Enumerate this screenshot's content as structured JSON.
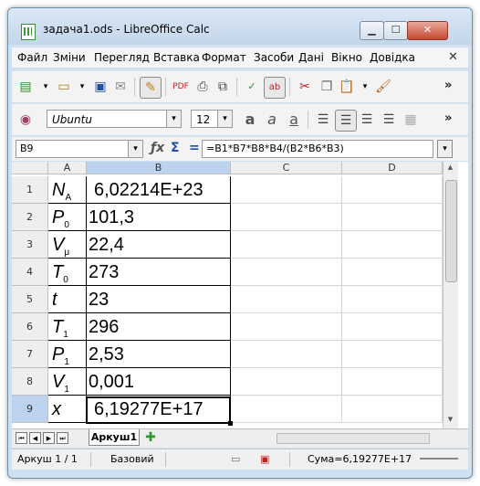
{
  "window": {
    "title": "задача1.ods - LibreOffice Calc"
  },
  "menu": [
    "Файл",
    "Зміни",
    "Перегляд",
    "Вставка",
    "Формат",
    "Засоби",
    "Дані",
    "Вікно",
    "Довідка"
  ],
  "font_toolbar": {
    "font_name": "Ubuntu",
    "font_size": "12"
  },
  "formula_bar": {
    "cell_ref": "B9",
    "fx": "ƒx",
    "sum": "Σ",
    "equals": "=",
    "formula": "=B1*B7*B8*B4/(B2*B6*B3)"
  },
  "columns": [
    "A",
    "B",
    "C",
    "D"
  ],
  "rows": [
    {
      "n": "1",
      "label_main": "N",
      "label_sub": "A",
      "value": "6,02214E+23"
    },
    {
      "n": "2",
      "label_main": "P",
      "label_sub": "0",
      "value": "101,3"
    },
    {
      "n": "3",
      "label_main": "V",
      "label_sub": "μ",
      "value": "22,4"
    },
    {
      "n": "4",
      "label_main": "T",
      "label_sub": "0",
      "value": "273"
    },
    {
      "n": "5",
      "label_main": "t",
      "label_sub": "",
      "value": "23"
    },
    {
      "n": "6",
      "label_main": "T",
      "label_sub": "1",
      "value": "296"
    },
    {
      "n": "7",
      "label_main": "P",
      "label_sub": "1",
      "value": "2,53"
    },
    {
      "n": "8",
      "label_main": "V",
      "label_sub": "1",
      "value": "0,001"
    },
    {
      "n": "9",
      "label_main": "x",
      "label_sub": "",
      "value": "6,19277E+17"
    }
  ],
  "sheet_tab": "Аркуш1",
  "status": {
    "sheet": "Аркуш 1 / 1",
    "style": "Базовий",
    "sum": "Сума=6,19277E+17"
  }
}
